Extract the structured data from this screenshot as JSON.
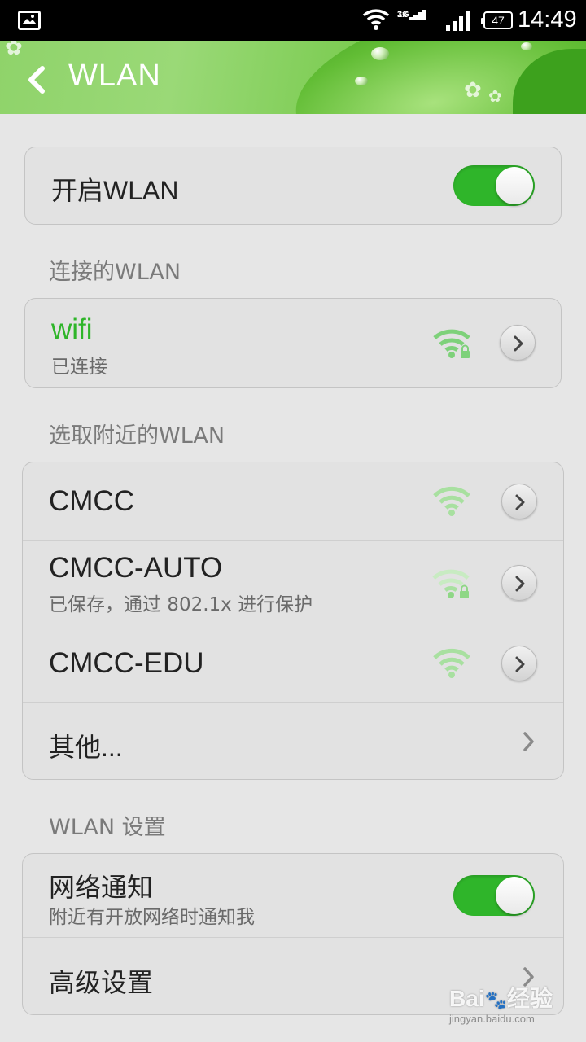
{
  "status_bar": {
    "network_top": "3G",
    "network_bottom": "1x",
    "battery": "47",
    "time": "14:49",
    "icons": [
      "image-icon",
      "wifi-icon",
      "signal-icon",
      "battery-icon"
    ]
  },
  "header": {
    "title": "WLAN",
    "back_icon": "chevron-left-icon"
  },
  "wlan_toggle": {
    "label": "开启WLAN",
    "on": true
  },
  "connected_section": {
    "title": "连接的WLAN",
    "network": {
      "name": "wifi",
      "status": "已连接",
      "secured": true,
      "name_color": "#2fb52a"
    }
  },
  "nearby_section": {
    "title": "选取附近的WLAN",
    "networks": [
      {
        "name": "CMCC",
        "status": "",
        "secured": false
      },
      {
        "name": "CMCC-AUTO",
        "status": "已保存，通过 802.1x 进行保护",
        "secured": true
      },
      {
        "name": "CMCC-EDU",
        "status": "",
        "secured": false
      }
    ],
    "other_label": "其他..."
  },
  "settings_section": {
    "title": "WLAN 设置",
    "network_notify": {
      "label": "网络通知",
      "description": "附近有开放网络时通知我",
      "on": true
    },
    "advanced_label": "高级设置"
  },
  "colors": {
    "accent": "#2fb52a",
    "background": "#e6e6e6",
    "wifi_icon": "#7ed17a"
  },
  "watermark": {
    "brand": "Bai du 经验",
    "url": "jingyan.baidu.com"
  }
}
